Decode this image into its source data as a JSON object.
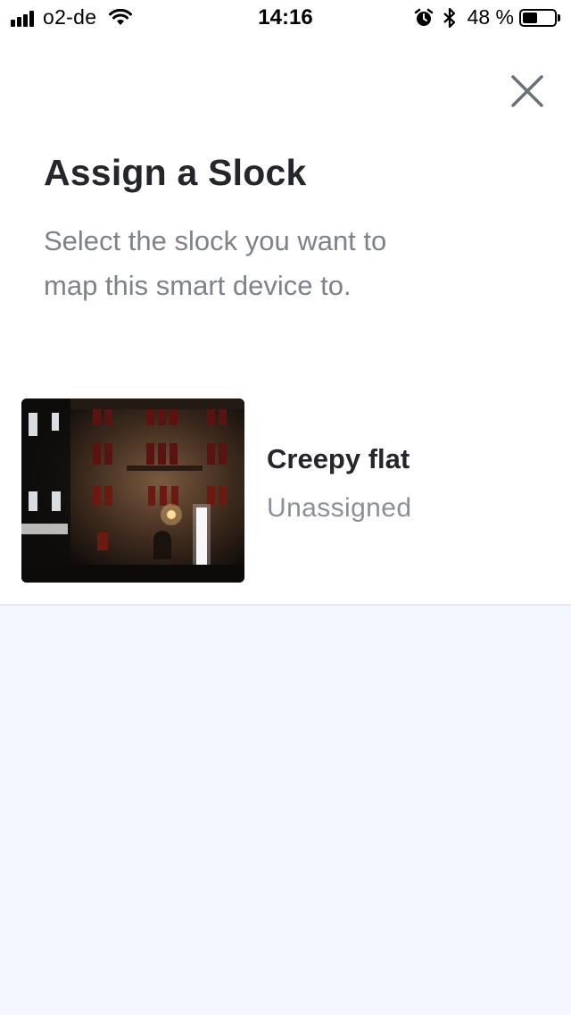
{
  "status_bar": {
    "carrier": "o2-de",
    "time": "14:16",
    "battery_percent": "48 %",
    "battery_level": 0.48,
    "icons": [
      "signal-icon",
      "wifi-icon",
      "alarm-icon",
      "bluetooth-icon",
      "battery-icon"
    ]
  },
  "close_icon": "close-icon",
  "title": "Assign a Slock",
  "subtitle": "Select the slock you want to map this smart device to.",
  "slocks": [
    {
      "name": "Creepy flat",
      "status": "Unassigned",
      "thumbnail": "building-facade-at-night"
    }
  ],
  "colors": {
    "title": "#24262b",
    "subtitle": "#7d828b",
    "status": "#8a8f98",
    "background_empty": "#f4f7fd",
    "divider": "#e6e8ee"
  }
}
